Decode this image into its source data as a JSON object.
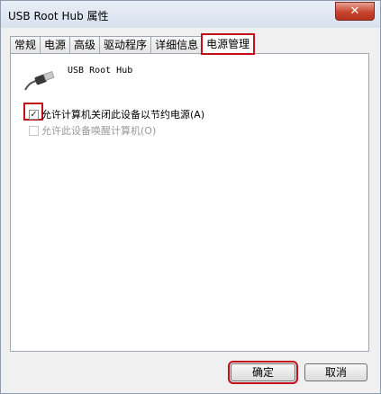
{
  "window": {
    "title": "USB Root Hub 属性",
    "close_glyph": "✕"
  },
  "tabs": [
    {
      "label": "常规"
    },
    {
      "label": "电源"
    },
    {
      "label": "高级"
    },
    {
      "label": "驱动程序"
    },
    {
      "label": "详细信息"
    },
    {
      "label": "电源管理",
      "active": true
    }
  ],
  "device": {
    "name": "USB Root Hub",
    "icon": "usb-plug-icon"
  },
  "options": [
    {
      "label": "允许计算机关闭此设备以节约电源(A)",
      "checked": true,
      "enabled": true
    },
    {
      "label": "允许此设备唤醒计算机(O)",
      "checked": false,
      "enabled": false
    }
  ],
  "buttons": {
    "ok_label": "确定",
    "cancel_label": "取消"
  },
  "colors": {
    "highlight": "#c40f1a",
    "close_button": "#c7452f"
  }
}
